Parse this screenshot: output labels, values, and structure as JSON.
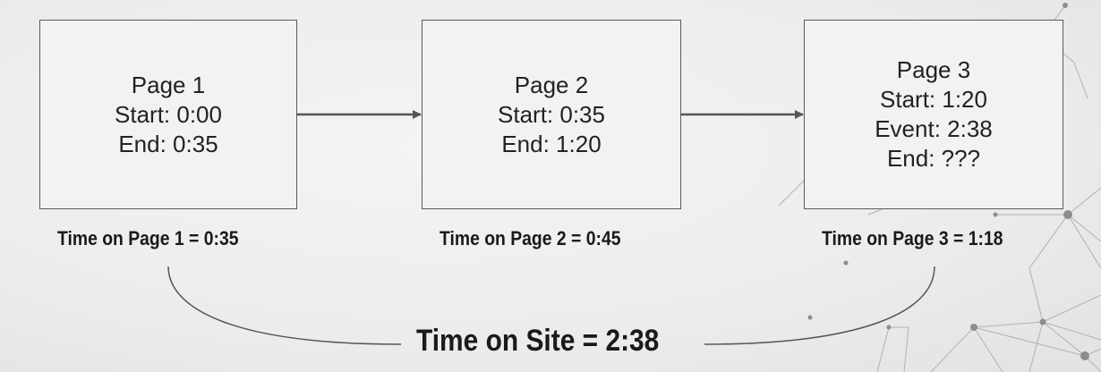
{
  "pages": [
    {
      "title": "Page 1",
      "lines": [
        "Start: 0:00",
        "End: 0:35"
      ],
      "time_label": "Time on Page 1 = 0:35"
    },
    {
      "title": "Page 2",
      "lines": [
        "Start: 0:35",
        "End: 1:20"
      ],
      "time_label": "Time on Page 2 = 0:45"
    },
    {
      "title": "Page 3",
      "lines": [
        "Start: 1:20",
        "Event: 2:38",
        "End: ???"
      ],
      "time_label": "Time on Page 3 = 1:18"
    }
  ],
  "site_label": "Time on Site = 2:38",
  "colors": {
    "background": "#ececec",
    "box_fill": "#f2f2f2",
    "box_border": "#5b5b5b",
    "arrow": "#555555",
    "curve": "#555555",
    "network_decoration": "#9a9a9a"
  }
}
